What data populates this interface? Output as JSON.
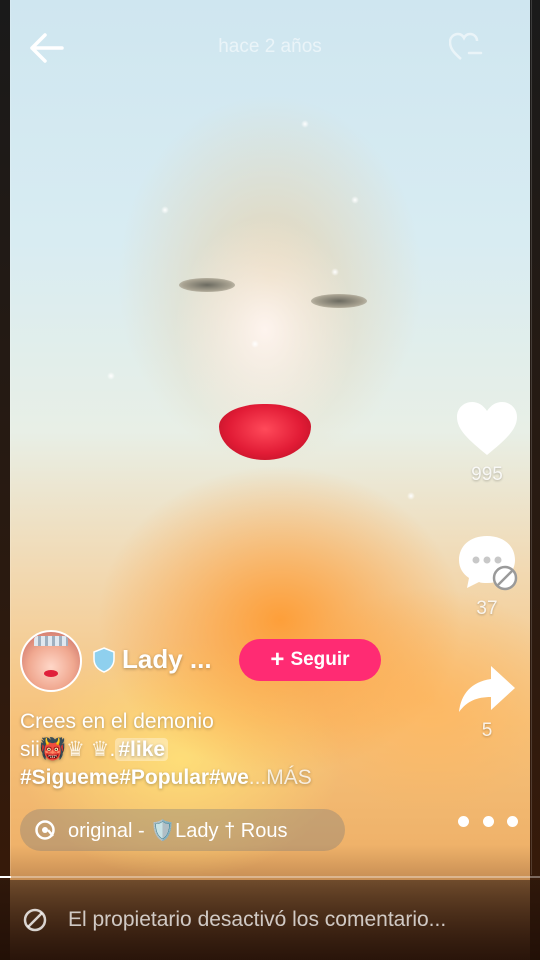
{
  "header": {
    "back_icon": "arrow-left-icon",
    "timestamp": "hace 2 años",
    "top_icon": "heart-badge-icon"
  },
  "rail": {
    "like": {
      "icon": "heart-icon",
      "count": "995"
    },
    "comment": {
      "icon": "comment-disabled-icon",
      "count": "37"
    },
    "share": {
      "icon": "share-arrow-icon",
      "count": "5"
    },
    "more_icon": "more-dots-icon"
  },
  "author": {
    "name": "Lady ...",
    "badge_icon": "shield-icon",
    "follow_label": "Seguir",
    "follow_icon": "plus-icon"
  },
  "caption": {
    "line1": "Crees en el demonio",
    "line2_prefix": "sii",
    "line2_hashtag": "#like",
    "line3_hashtags": "#Sigueme#Popular#we",
    "line3_ellipsis": "...",
    "more_label": "MÁS"
  },
  "sound": {
    "icon": "music-disc-icon",
    "text": "original - 🛡️Lady † Rous"
  },
  "progress": {
    "played": 0.02
  },
  "footer": {
    "icon": "ban-icon",
    "notice": "El propietario desactivó los comentario..."
  },
  "colors": {
    "follow_button": "#ff2b73",
    "text": "#ffffff"
  }
}
